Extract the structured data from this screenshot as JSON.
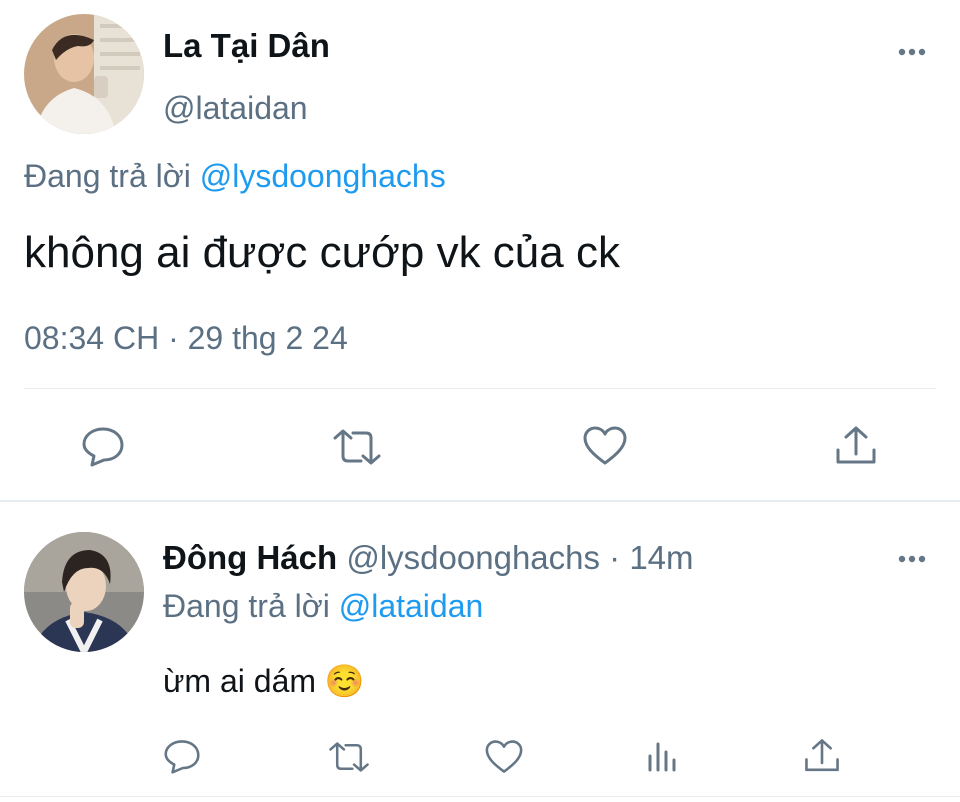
{
  "main_tweet": {
    "display_name": "La Tại Dân",
    "handle": "@lataidan",
    "replying_prefix": "Đang trả lời",
    "replying_to": "@lysdoonghachs",
    "text": "không ai được cướp vk của ck",
    "timestamp": "08:34 CH · 29 thg 2 24"
  },
  "reply_tweet": {
    "display_name": "Đông Hách",
    "handle": "@lysdoonghachs",
    "time_ago": "· 14m",
    "replying_prefix": "Đang trả lời",
    "replying_to": "@lataidan",
    "text": "ừm ai dám",
    "emoji": "☺️"
  },
  "colors": {
    "accent": "#1d9bf0",
    "muted": "#5b7083",
    "icon": "#657786",
    "divider": "#e6ecf0"
  },
  "icons": {
    "main_actions": [
      "reply-icon",
      "retweet-icon",
      "like-icon",
      "share-icon"
    ],
    "reply_actions": [
      "reply-icon",
      "retweet-icon",
      "like-icon",
      "analytics-icon",
      "share-icon"
    ],
    "more": "more-options-icon"
  }
}
